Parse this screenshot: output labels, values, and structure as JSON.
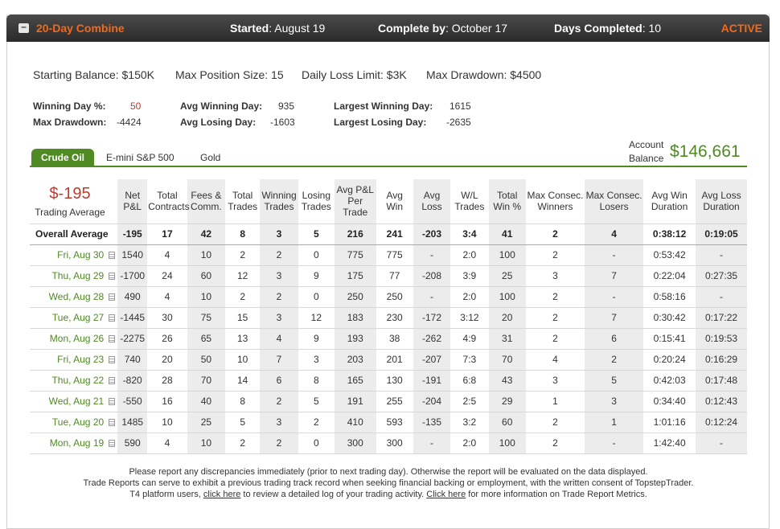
{
  "header": {
    "toggle": "–",
    "combine_name": "20-Day Combine",
    "started_label": "Started",
    "started_value": ": August 19",
    "complete_label": "Complete by",
    "complete_value": ": October 17",
    "days_label": "Days Completed",
    "days_value": ": 10",
    "status": "ACTIVE"
  },
  "rules": {
    "starting_balance": "Starting Balance: $150K",
    "max_position": "Max Position Size: 15",
    "daily_loss": "Daily Loss Limit: $3K",
    "max_drawdown": "Max Drawdown: $4500"
  },
  "stats": {
    "winning_day_pct_label": "Winning Day %:",
    "winning_day_pct": "50",
    "max_drawdown_label": "Max Drawdown:",
    "max_drawdown": "-4424",
    "avg_winning_day_label": "Avg Winning Day:",
    "avg_winning_day": "935",
    "avg_losing_day_label": "Avg Losing Day:",
    "avg_losing_day": "-1603",
    "largest_winning_day_label": "Largest Winning Day:",
    "largest_winning_day": "1615",
    "largest_losing_day_label": "Largest Losing Day:",
    "largest_losing_day": "-2635"
  },
  "tabs": [
    "Crude Oil",
    "E-mini S&P 500",
    "Gold"
  ],
  "account": {
    "label_line1": "Account",
    "label_line2": "Balance",
    "value": "$146,661"
  },
  "trading_average": {
    "value": "$-195",
    "label": "Trading Average"
  },
  "columns": [
    "Net P&L",
    "Total Contracts",
    "Fees & Comm.",
    "Total Trades",
    "Winning Trades",
    "Losing Trades",
    "Avg P&L Per Trade",
    "Avg Win",
    "Avg Loss",
    "W/L Trades",
    "Total Win %",
    "Max Consec. Winners",
    "Max Consec. Losers",
    "Avg Win Duration",
    "Avg Loss Duration"
  ],
  "overall": {
    "label": "Overall Average",
    "cells": [
      "-195",
      "17",
      "42",
      "8",
      "3",
      "5",
      "216",
      "241",
      "-203",
      "3:4",
      "41",
      "2",
      "4",
      "0:38:12",
      "0:19:05"
    ]
  },
  "rows": [
    {
      "date": "Fri, Aug 30",
      "cells": [
        "1540",
        "4",
        "10",
        "2",
        "2",
        "0",
        "775",
        "775",
        "-",
        "2:0",
        "100",
        "2",
        "-",
        "0:53:42",
        "-"
      ]
    },
    {
      "date": "Thu, Aug 29",
      "cells": [
        "-1700",
        "24",
        "60",
        "12",
        "3",
        "9",
        "175",
        "77",
        "-208",
        "3:9",
        "25",
        "3",
        "7",
        "0:22:04",
        "0:27:35"
      ]
    },
    {
      "date": "Wed, Aug 28",
      "cells": [
        "490",
        "4",
        "10",
        "2",
        "2",
        "0",
        "250",
        "250",
        "-",
        "2:0",
        "100",
        "2",
        "-",
        "0:58:16",
        "-"
      ]
    },
    {
      "date": "Tue, Aug 27",
      "cells": [
        "-1445",
        "30",
        "75",
        "15",
        "3",
        "12",
        "183",
        "230",
        "-172",
        "3:12",
        "20",
        "2",
        "7",
        "0:30:42",
        "0:17:22"
      ]
    },
    {
      "date": "Mon, Aug 26",
      "cells": [
        "-2275",
        "26",
        "65",
        "13",
        "4",
        "9",
        "193",
        "38",
        "-262",
        "4:9",
        "31",
        "2",
        "6",
        "0:15:41",
        "0:19:53"
      ]
    },
    {
      "date": "Fri, Aug 23",
      "cells": [
        "740",
        "20",
        "50",
        "10",
        "7",
        "3",
        "203",
        "201",
        "-207",
        "7:3",
        "70",
        "4",
        "2",
        "0:20:24",
        "0:16:29"
      ]
    },
    {
      "date": "Thu, Aug 22",
      "cells": [
        "-820",
        "28",
        "70",
        "14",
        "6",
        "8",
        "165",
        "130",
        "-191",
        "6:8",
        "43",
        "3",
        "5",
        "0:42:03",
        "0:17:48"
      ]
    },
    {
      "date": "Wed, Aug 21",
      "cells": [
        "-550",
        "16",
        "40",
        "8",
        "2",
        "5",
        "191",
        "255",
        "-204",
        "2:5",
        "29",
        "1",
        "3",
        "0:34:40",
        "0:12:43"
      ]
    },
    {
      "date": "Tue, Aug 20",
      "cells": [
        "1485",
        "10",
        "25",
        "5",
        "3",
        "2",
        "410",
        "593",
        "-135",
        "3:2",
        "60",
        "2",
        "1",
        "1:01:16",
        "0:12:24"
      ]
    },
    {
      "date": "Mon, Aug 19",
      "cells": [
        "590",
        "4",
        "10",
        "2",
        "2",
        "0",
        "300",
        "300",
        "-",
        "2:0",
        "100",
        "2",
        "-",
        "1:42:40",
        "-"
      ]
    }
  ],
  "footer": {
    "line1": "Please report any discrepancies immediately (prior to next trading day). Otherwise the report will be evaluated on the data displayed.",
    "line2": "Trade Reports can serve to exhibit a previous trading track record when seeking financial backing or employment, with the written consent of TopstepTrader.",
    "line3_a": "T4 platform users, ",
    "link1": "click here",
    "line3_b": " to review a detailed log of your trading activity. ",
    "link2": "Click here",
    "line3_c": " for more information on Trade Report Metrics."
  }
}
